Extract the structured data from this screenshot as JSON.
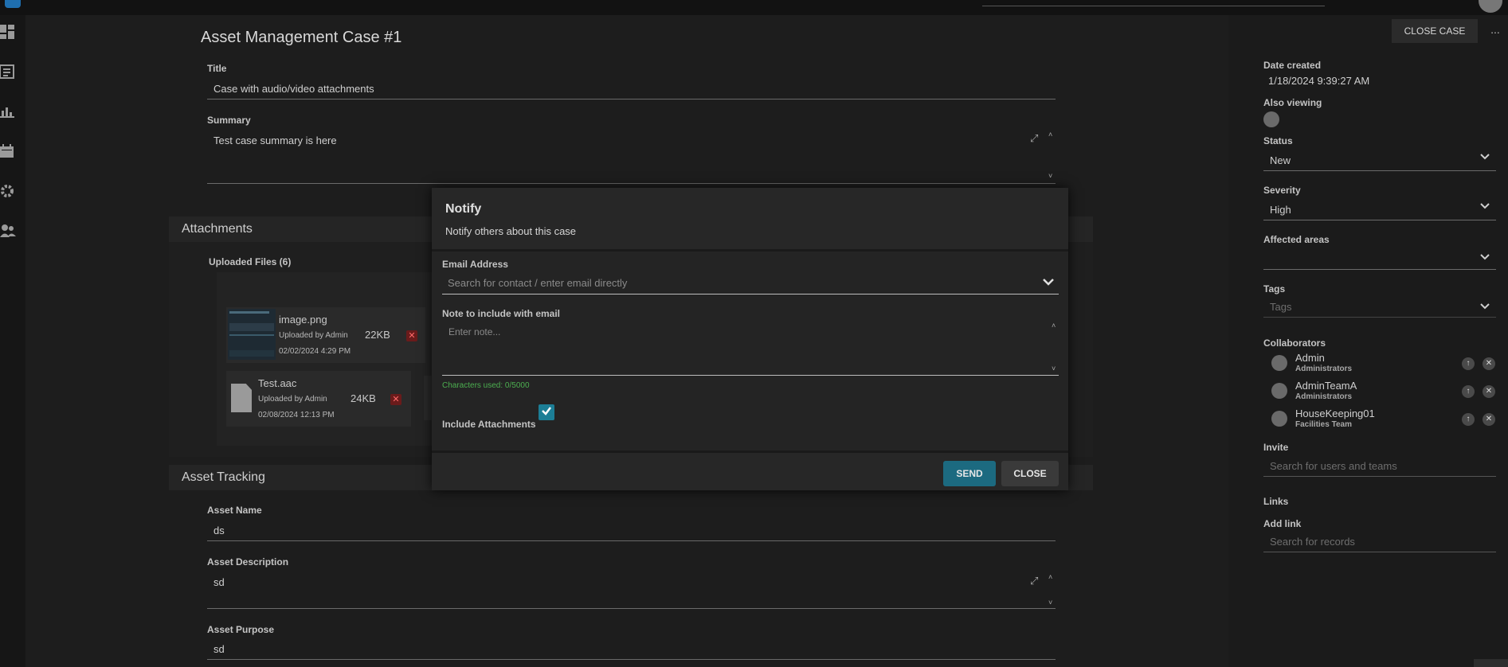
{
  "header": {
    "close_case_label": "CLOSE CASE",
    "more_label": "..."
  },
  "case": {
    "page_title": "Asset Management Case #1",
    "title_label": "Title",
    "title_value": "Case with audio/video attachments",
    "summary_label": "Summary",
    "summary_value": "Test case summary is here"
  },
  "attachments": {
    "section_title": "Attachments",
    "uploaded_label": "Uploaded Files (6)",
    "files": [
      {
        "name": "image.png",
        "uploaded_by": "Uploaded by Admin",
        "date": "02/02/2024 4:29 PM",
        "size": "22KB",
        "delete": "✕"
      },
      {
        "name": "Test.aac",
        "uploaded_by": "Uploaded by Admin",
        "date": "02/08/2024 12:13 PM",
        "size": "24KB",
        "delete": "✕"
      }
    ]
  },
  "asset_tracking": {
    "section_title": "Asset Tracking",
    "asset_name_label": "Asset Name",
    "asset_name_value": "ds",
    "asset_desc_label": "Asset Description",
    "asset_desc_value": "sd",
    "asset_purpose_label": "Asset Purpose",
    "asset_purpose_value": "sd"
  },
  "side": {
    "date_created_label": "Date created",
    "date_created_value": "1/18/2024 9:39:27 AM",
    "also_viewing_label": "Also viewing",
    "status_label": "Status",
    "status_value": "New",
    "severity_label": "Severity",
    "severity_value": "High",
    "affected_label": "Affected areas",
    "tags_label": "Tags",
    "tags_placeholder": "Tags",
    "collaborators_label": "Collaborators",
    "collaborators": [
      {
        "name": "Admin",
        "team": "Administrators"
      },
      {
        "name": "AdminTeamA",
        "team": "Administrators"
      },
      {
        "name": "HouseKeeping01",
        "team": "Facilities Team"
      }
    ],
    "invite_label": "Invite",
    "invite_placeholder": "Search for users and teams",
    "links_label": "Links",
    "add_link_label": "Add link",
    "add_link_placeholder": "Search for records"
  },
  "modal": {
    "title": "Notify",
    "subtitle": "Notify others about this case",
    "email_label": "Email Address",
    "email_placeholder": "Search for contact / enter email directly",
    "note_label": "Note to include with email",
    "note_placeholder": "Enter note...",
    "chars_used": "Characters used: 0/5000",
    "include_attachments_label": "Include Attachments",
    "include_attachments_checked": true,
    "send_label": "SEND",
    "close_label": "CLOSE"
  },
  "icons": {
    "dashboard": "dashboard-icon",
    "list": "list-icon",
    "chart": "chart-icon",
    "calendar": "calendar-icon",
    "settings": "gear-icon",
    "users": "users-icon"
  },
  "colors": {
    "accent": "#1c7e96",
    "send": "#1c6a80",
    "delete": "#6a1b1b"
  }
}
